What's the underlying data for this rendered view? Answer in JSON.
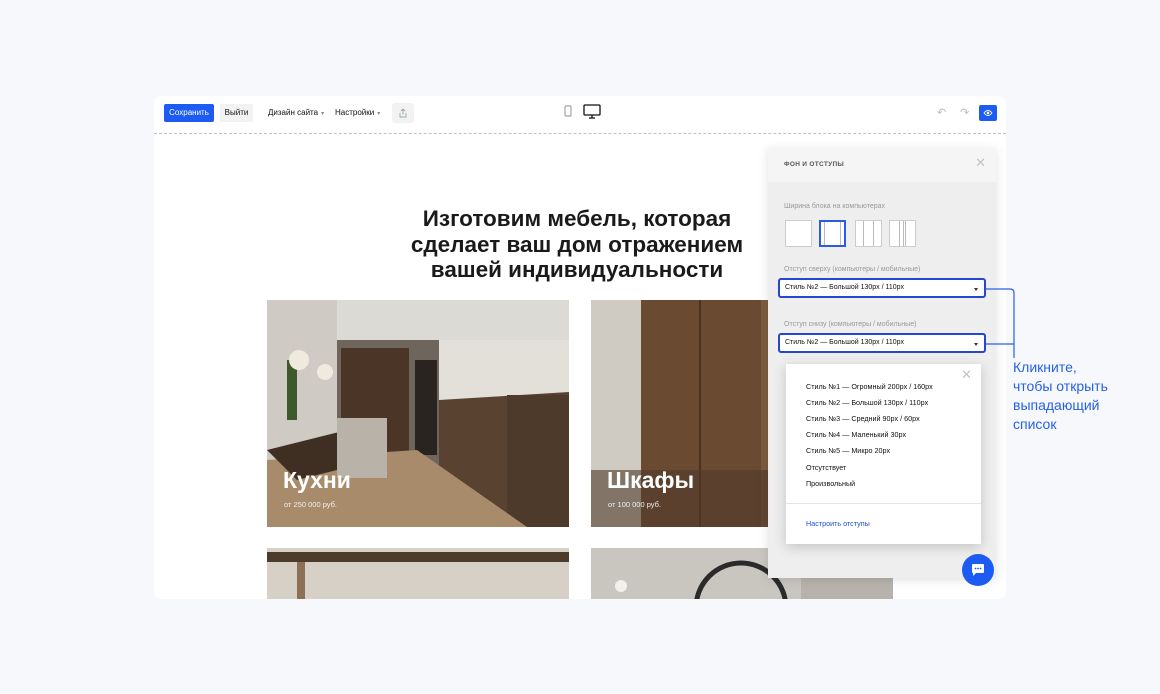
{
  "toolbar": {
    "save_label": "Сохранить",
    "exit_label": "Выйти",
    "menu_design": "Дизайн сайта",
    "menu_settings": "Настройки"
  },
  "page": {
    "headline_lines": [
      "Изготовим мебель, которая",
      "сделает ваш дом отражением",
      "вашей индивидуальности"
    ],
    "cards": [
      {
        "title": "Кухни",
        "price": "от 250 000 руб."
      },
      {
        "title": "Шкафы",
        "price": "от 100 000 руб."
      }
    ]
  },
  "panel": {
    "title": "ФОН И ОТСТУПЫ",
    "width_label": "Ширина блока на компьютерах",
    "top_label": "Отступ сверху (компьютеры / мобильные)",
    "top_value": "Стиль №2 — Большой 130px / 110px",
    "bottom_label": "Отступ снизу (компьютеры / мобильные)",
    "bottom_value": "Стиль №2 — Большой 130px / 110px"
  },
  "dropdown": {
    "options": [
      "Стиль №1 — Огромный 200px / 160px",
      "Стиль №2 — Большой 130px / 110px",
      "Стиль №3 — Средний 90px / 60px",
      "Стиль №4 — Маленький 30px",
      "Стиль №5 — Микро 20px",
      "Отсутствует",
      "Произвольный"
    ],
    "link": "Настроить отступы"
  },
  "annotation": {
    "lines": [
      "Кликните,",
      "чтобы открыть",
      "выпадающий",
      "список"
    ]
  },
  "colors": {
    "accent": "#1c5cf2",
    "annotation": "#2560e8",
    "select_border": "#2547d0"
  }
}
